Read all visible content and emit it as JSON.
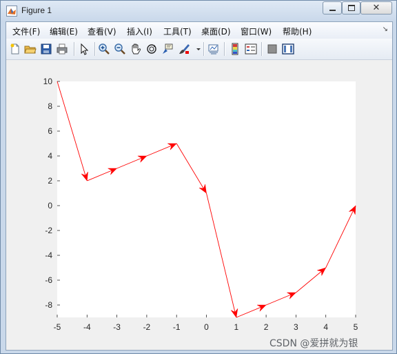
{
  "window": {
    "title": "Figure 1"
  },
  "menu": [
    {
      "label": "文件(F)"
    },
    {
      "label": "编辑(E)"
    },
    {
      "label": "查看(V)"
    },
    {
      "label": "插入(I)"
    },
    {
      "label": "工具(T)"
    },
    {
      "label": "桌面(D)"
    },
    {
      "label": "窗口(W)"
    },
    {
      "label": "帮助(H)"
    }
  ],
  "toolbar": [
    {
      "icon": "new-figure-icon"
    },
    {
      "icon": "open-file-icon"
    },
    {
      "icon": "save-icon"
    },
    {
      "icon": "print-icon"
    },
    {
      "icon": "pointer-icon"
    },
    {
      "icon": "zoom-in-icon"
    },
    {
      "icon": "zoom-out-icon"
    },
    {
      "icon": "pan-hand-icon"
    },
    {
      "icon": "rotate-3d-icon"
    },
    {
      "icon": "data-cursor-icon"
    },
    {
      "icon": "brush-icon"
    },
    {
      "icon": "link-plot-icon"
    },
    {
      "icon": "colorbar-icon"
    },
    {
      "icon": "legend-icon"
    },
    {
      "icon": "hide-plot-tools-icon"
    },
    {
      "icon": "show-plot-tools-icon"
    }
  ],
  "colors": {
    "arrow": "#ff0000",
    "axes_bg": "#ffffff",
    "figure_bg": "#f0f0f0"
  },
  "chart_data": {
    "type": "line",
    "style": "quiver-arrows",
    "x": [
      -5,
      -4,
      -3,
      -2,
      -1,
      0,
      1,
      2,
      3,
      4,
      5
    ],
    "y": [
      10,
      2,
      3,
      4,
      5,
      1,
      -9,
      -8,
      -7,
      -5,
      0
    ],
    "xlim": [
      -5,
      5
    ],
    "ylim": [
      -9,
      10
    ],
    "xticks": [
      -5,
      -4,
      -3,
      -2,
      -1,
      0,
      1,
      2,
      3,
      4,
      5
    ],
    "yticks": [
      -8,
      -6,
      -4,
      -2,
      0,
      2,
      4,
      6,
      8,
      10
    ],
    "grid": false
  },
  "watermark": "CSDN @爱拼就为银"
}
